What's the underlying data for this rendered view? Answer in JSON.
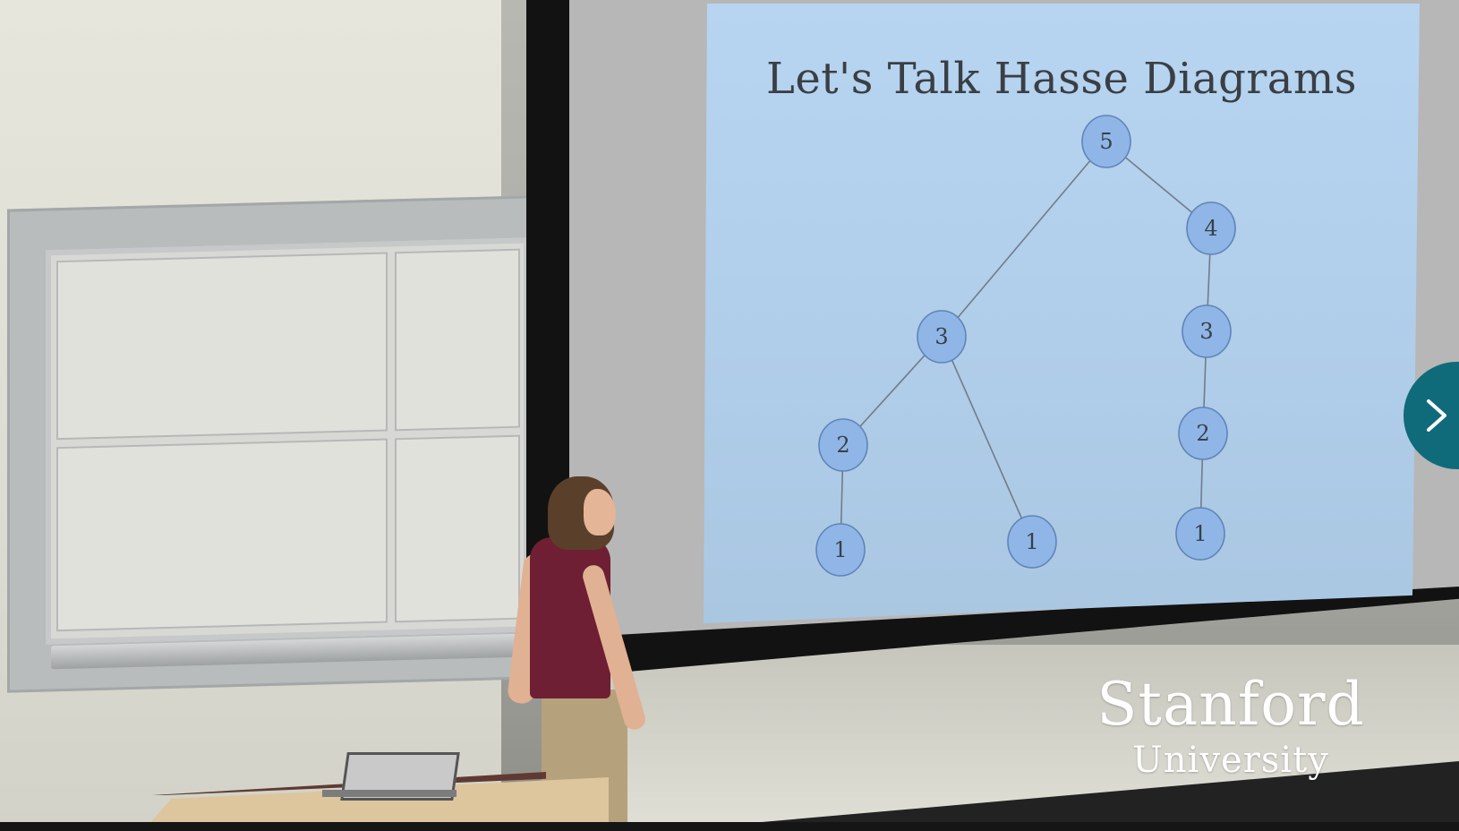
{
  "slide": {
    "title": "Let's Talk Hasse Diagrams",
    "nodes": [
      {
        "id": "n5",
        "label": "5"
      },
      {
        "id": "n4",
        "label": "4"
      },
      {
        "id": "n3a",
        "label": "3"
      },
      {
        "id": "n3b",
        "label": "3"
      },
      {
        "id": "n2a",
        "label": "2"
      },
      {
        "id": "n2b",
        "label": "2"
      },
      {
        "id": "n1a",
        "label": "1"
      },
      {
        "id": "n1b",
        "label": "1"
      },
      {
        "id": "n1c",
        "label": "1"
      }
    ],
    "edges": [
      [
        "n5",
        "n3a"
      ],
      [
        "n5",
        "n4"
      ],
      [
        "n3a",
        "n2a"
      ],
      [
        "n3a",
        "n1b"
      ],
      [
        "n2a",
        "n1a"
      ],
      [
        "n4",
        "n3b"
      ],
      [
        "n3b",
        "n2b"
      ],
      [
        "n2b",
        "n1c"
      ]
    ]
  },
  "watermark": {
    "line1": "Stanford",
    "line2": "University"
  },
  "controls": {
    "next_icon": "chevron-right-icon"
  },
  "colors": {
    "slide_background": "#b3d1ee",
    "node_fill": "#8fb6e6",
    "node_stroke": "#5f84b7",
    "next_button": "#0f6b7a"
  }
}
